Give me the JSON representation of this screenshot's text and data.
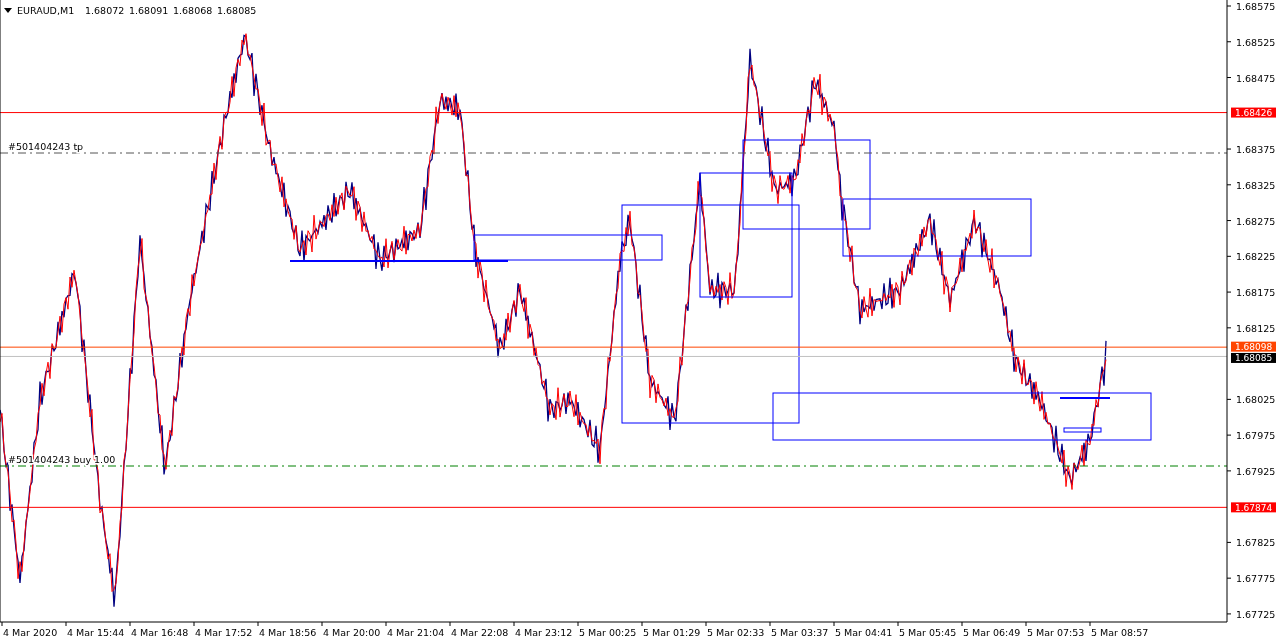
{
  "header": {
    "symbol": "EURAUD,M1",
    "quotes": [
      "1.68072",
      "1.68091",
      "1.68068",
      "1.68085"
    ]
  },
  "price_ticks": [
    "1.68575",
    "1.68525",
    "1.68475",
    "1.68375",
    "1.68325",
    "1.68275",
    "1.68225",
    "1.68175",
    "1.68125",
    "1.68025",
    "1.67975",
    "1.67925",
    "1.67825",
    "1.67775",
    "1.67725"
  ],
  "time_labels": [
    "4 Mar 2020",
    "4 Mar 15:44",
    "4 Mar 16:48",
    "4 Mar 17:52",
    "4 Mar 18:56",
    "4 Mar 20:00",
    "4 Mar 21:04",
    "4 Mar 22:08",
    "4 Mar 23:12",
    "5 Mar 00:25",
    "5 Mar 01:29",
    "5 Mar 02:33",
    "5 Mar 03:37",
    "5 Mar 04:41",
    "5 Mar 05:45",
    "5 Mar 06:49",
    "5 Mar 07:53",
    "5 Mar 08:57"
  ],
  "price_lines": [
    {
      "kind": "level",
      "price": "1.68426"
    },
    {
      "kind": "ask",
      "price": "1.68098"
    },
    {
      "kind": "bid",
      "price": "1.68085"
    },
    {
      "kind": "level",
      "price": "1.67874"
    }
  ],
  "order_lines": [
    {
      "kind": "take_profit",
      "label": "#501404243 tp"
    },
    {
      "kind": "entry",
      "label": "#501404243 buy 1.00"
    }
  ]
}
